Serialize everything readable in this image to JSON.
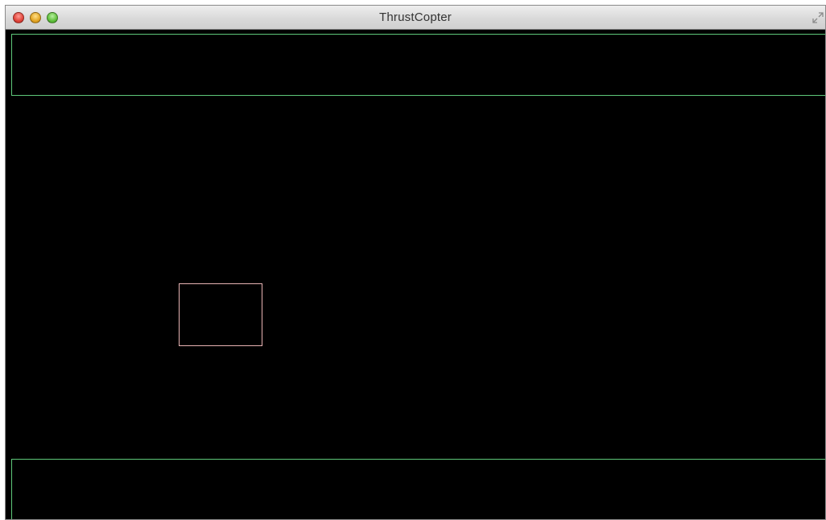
{
  "window": {
    "title": "ThrustCopter"
  },
  "icons": {
    "close": "close-button",
    "minimize": "minimize-button",
    "zoom": "zoom-button",
    "fullscreen": "fullscreen-icon"
  },
  "colors": {
    "background": "#000000",
    "wall_outline": "#5ec87a",
    "copter_outline": "#e8b4b4"
  }
}
